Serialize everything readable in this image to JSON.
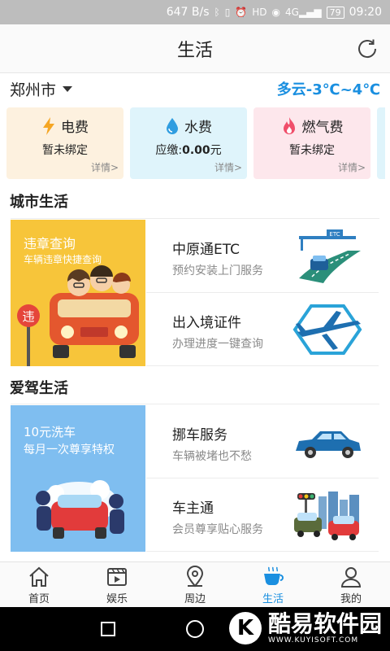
{
  "status_bar": {
    "network_speed": "647 B/s",
    "signal": "4G",
    "battery": "79",
    "time": "09:20"
  },
  "header": {
    "title": "生活"
  },
  "location": {
    "city": "郑州市",
    "weather": "多云-3℃~4℃"
  },
  "utility_cards": [
    {
      "name": "电费",
      "status": "暂未绑定",
      "detail": "详情>",
      "icon": "lightning-icon",
      "color": "#f5a623"
    },
    {
      "name": "水费",
      "status_prefix": "应缴:",
      "status_value": "0.00",
      "status_suffix": "元",
      "detail": "详情>",
      "icon": "water-drop-icon",
      "color": "#2f9de0"
    },
    {
      "name": "燃气费",
      "status": "暂未绑定",
      "detail": "详情>",
      "icon": "flame-icon",
      "color": "#f04e6a"
    }
  ],
  "sections": {
    "city_life": {
      "title": "城市生活",
      "banner": {
        "title": "违章查询",
        "subtitle": "车辆违章快捷查询",
        "sign": "违"
      },
      "items": [
        {
          "title": "中原通ETC",
          "subtitle": "预约安装上门服务",
          "icon": "etc-road-icon"
        },
        {
          "title": "出入境证件",
          "subtitle": "办理进度一键查询",
          "icon": "airplane-icon"
        }
      ]
    },
    "driving_life": {
      "title": "爱驾生活",
      "banner": {
        "title": "10元洗车",
        "subtitle": "每月一次尊享特权"
      },
      "items": [
        {
          "title": "挪车服务",
          "subtitle": "车辆被堵也不愁",
          "icon": "car-icon"
        },
        {
          "title": "车主通",
          "subtitle": "会员尊享贴心服务",
          "icon": "city-traffic-icon"
        }
      ]
    }
  },
  "bottom_nav": [
    {
      "label": "首页",
      "icon": "home-icon"
    },
    {
      "label": "娱乐",
      "icon": "video-icon"
    },
    {
      "label": "周边",
      "icon": "location-pin-icon"
    },
    {
      "label": "生活",
      "icon": "coffee-cup-icon",
      "active": true
    },
    {
      "label": "我的",
      "icon": "user-icon"
    }
  ],
  "watermark": {
    "logo": "K",
    "text": "酷易软件园",
    "url": "WWW.KUYISOFT.COM"
  },
  "colors": {
    "accent": "#1a8fe0",
    "electric_card": "#fdf1df",
    "water_card": "#dff4fb",
    "gas_card": "#fde7ec",
    "banner_yellow": "#f7c53a",
    "banner_blue": "#7fbef0"
  }
}
